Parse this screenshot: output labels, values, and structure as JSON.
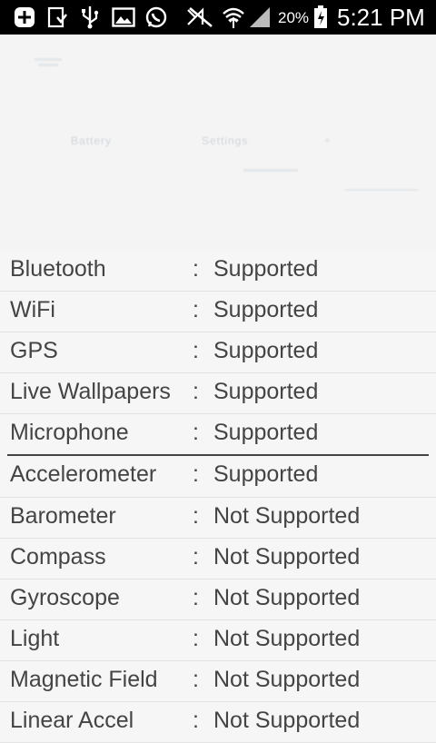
{
  "status_bar": {
    "battery_percent": "20%",
    "time": "5:21 PM",
    "icons": [
      "add-icon",
      "download-icon",
      "usb-icon",
      "image-icon",
      "whatsapp-icon",
      "mute-icon",
      "wifi-icon",
      "signal-icon",
      "battery-icon"
    ]
  },
  "header": {
    "faint_texts": [
      "Battery",
      "Settings"
    ]
  },
  "features": [
    {
      "label": "Bluetooth",
      "sep": ":",
      "value": "Supported"
    },
    {
      "label": "WiFi",
      "sep": ":",
      "value": "Supported"
    },
    {
      "label": "GPS",
      "sep": ":",
      "value": "Supported"
    },
    {
      "label": "Live Wallpapers",
      "sep": ":",
      "value": "Supported"
    },
    {
      "label": "Microphone",
      "sep": ":",
      "value": "Supported"
    }
  ],
  "sensors": [
    {
      "label": "Accelerometer",
      "sep": ":",
      "value": "Supported"
    },
    {
      "label": "Barometer",
      "sep": ":",
      "value": "Not Supported"
    },
    {
      "label": "Compass",
      "sep": ":",
      "value": "Not Supported"
    },
    {
      "label": "Gyroscope",
      "sep": ":",
      "value": "Not Supported"
    },
    {
      "label": "Light",
      "sep": ":",
      "value": "Not Supported"
    },
    {
      "label": "Magnetic Field",
      "sep": ":",
      "value": "Not Supported"
    },
    {
      "label": "Linear Accel",
      "sep": ":",
      "value": "Not Supported"
    }
  ]
}
